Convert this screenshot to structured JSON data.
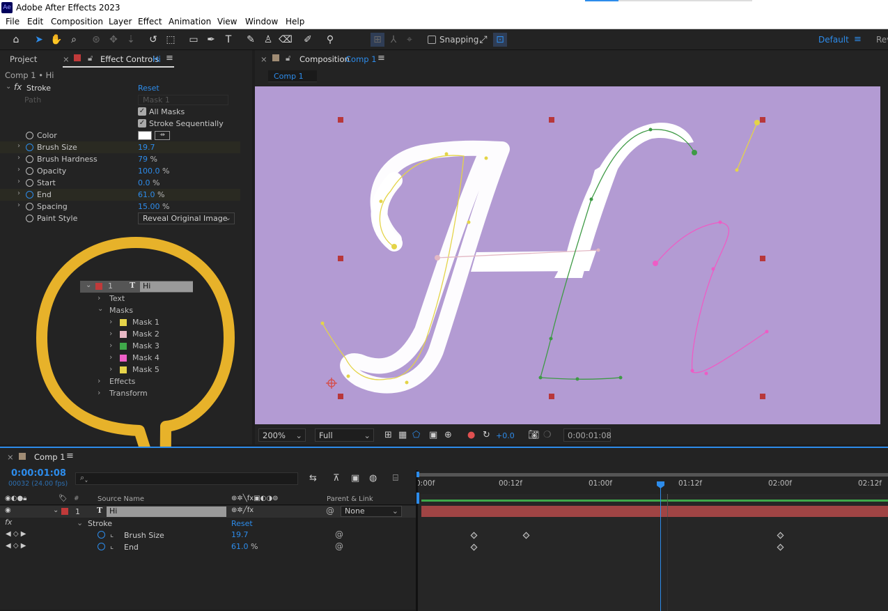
{
  "app": {
    "title": "Adobe After Effects 2023",
    "icon_text": "Ae"
  },
  "menu": [
    "File",
    "Edit",
    "Composition",
    "Layer",
    "Effect",
    "Animation",
    "View",
    "Window",
    "Help"
  ],
  "toolbar": {
    "snapping_label": "Snapping",
    "workspace": "Default",
    "workspace_next": "Rev"
  },
  "left_panel": {
    "tab_project": "Project",
    "tab_effect_controls": "Effect Controls",
    "tab_effect_controls_layer": "Hi",
    "breadcrumb": "Comp 1 • Hi",
    "effect_name": "Stroke",
    "reset": "Reset",
    "path_label": "Path",
    "path_value": "Mask 1",
    "all_masks": "All Masks",
    "stroke_seq": "Stroke Sequentially",
    "props": [
      {
        "label": "Color",
        "value": ""
      },
      {
        "label": "Brush Size",
        "value": "19.7",
        "unit": ""
      },
      {
        "label": "Brush Hardness",
        "value": "79",
        "unit": " %"
      },
      {
        "label": "Opacity",
        "value": "100.0",
        "unit": " %"
      },
      {
        "label": "Start",
        "value": "0.0",
        "unit": " %"
      },
      {
        "label": "End",
        "value": "61.0",
        "unit": " %"
      },
      {
        "label": "Spacing",
        "value": "15.00",
        "unit": " %"
      },
      {
        "label": "Paint Style",
        "value": "Reveal Original Image"
      }
    ]
  },
  "callout": {
    "layer_num": "1",
    "layer_name": "Hi",
    "text": "Text",
    "masks": "Masks",
    "mask_items": [
      {
        "name": "Mask 1",
        "color": "#e6d44a"
      },
      {
        "name": "Mask 2",
        "color": "#e9b9c6"
      },
      {
        "name": "Mask 3",
        "color": "#3fa84a"
      },
      {
        "name": "Mask 4",
        "color": "#f060c8"
      },
      {
        "name": "Mask 5",
        "color": "#e6d44a"
      }
    ],
    "effects": "Effects",
    "transform": "Transform",
    "ring_color": "#e7b22a"
  },
  "comp_panel": {
    "tab_label": "Composition",
    "tab_comp": "Comp 1",
    "sub_tab": "Comp 1",
    "bg_color": "#b39bd3",
    "zoom": "200%",
    "resolution": "Full",
    "exposure": "+0.0",
    "timecode": "0:00:01:08"
  },
  "timeline": {
    "tab": "Comp 1",
    "timecode": "0:00:01:08",
    "fps": "00032 (24.00 fps)",
    "col_source": "Source Name",
    "col_parent": "Parent & Link",
    "ruler": [
      "0:00f",
      "00:12f",
      "01:00f",
      "01:12f",
      "02:00f",
      "02:12f"
    ],
    "layer_num": "1",
    "layer_name": "Hi",
    "parent": "None",
    "stroke": "Stroke",
    "reset": "Reset",
    "brush_size_label": "Brush Size",
    "brush_size_value": "19.7",
    "end_label": "End",
    "end_value": "61.0",
    "end_unit": " %"
  }
}
